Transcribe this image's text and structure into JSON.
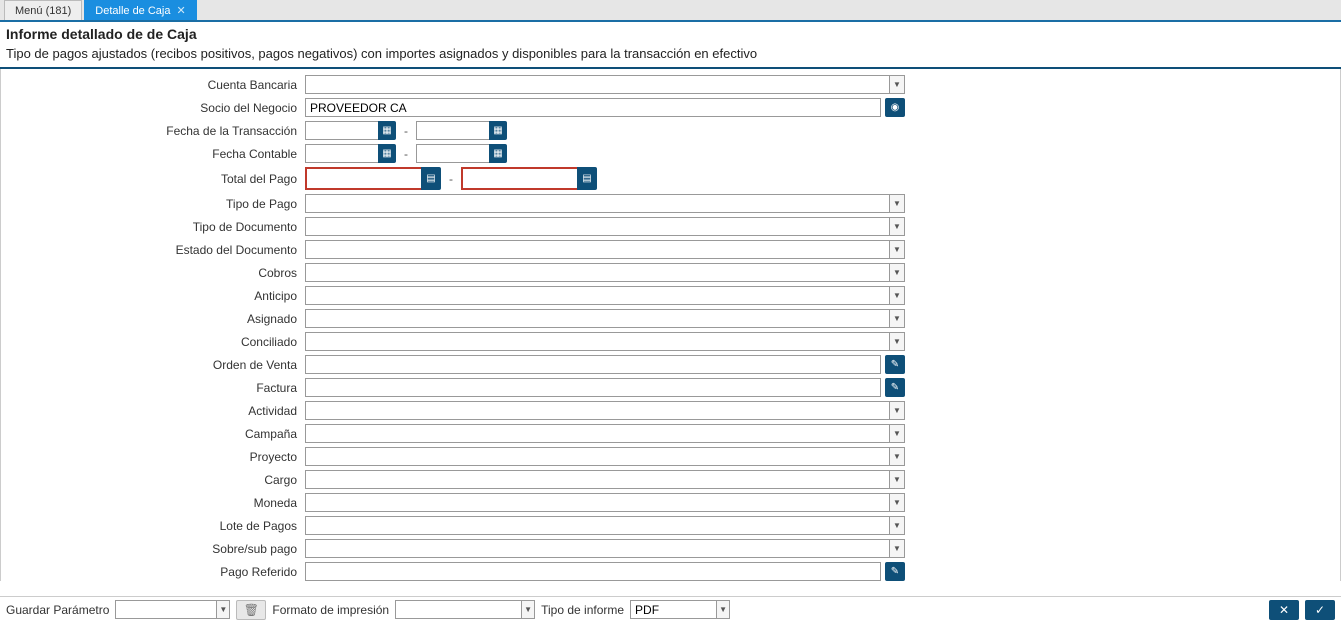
{
  "tabs": {
    "menu": "Menú (181)",
    "active": "Detalle de Caja"
  },
  "header": {
    "title": "Informe detallado de de Caja",
    "subtitle": "Tipo de pagos ajustados (recibos positivos, pagos negativos) con importes asignados y disponibles para la transacción en efectivo"
  },
  "labels": {
    "cuenta_bancaria": "Cuenta Bancaria",
    "socio_negocio": "Socio del Negocio",
    "fecha_transaccion": "Fecha de la Transacción",
    "fecha_contable": "Fecha Contable",
    "total_pago": "Total del Pago",
    "tipo_pago": "Tipo de Pago",
    "tipo_documento": "Tipo de Documento",
    "estado_documento": "Estado del Documento",
    "cobros": "Cobros",
    "anticipo": "Anticipo",
    "asignado": "Asignado",
    "conciliado": "Conciliado",
    "orden_venta": "Orden de Venta",
    "factura": "Factura",
    "actividad": "Actividad",
    "campana": "Campaña",
    "proyecto": "Proyecto",
    "cargo": "Cargo",
    "moneda": "Moneda",
    "lote_pagos": "Lote de Pagos",
    "sobre_sub_pago": "Sobre/sub pago",
    "pago_referido": "Pago Referido"
  },
  "values": {
    "cuenta_bancaria": "",
    "socio_negocio": "PROVEEDOR CA",
    "fecha_transaccion_from": "",
    "fecha_transaccion_to": "",
    "fecha_contable_from": "",
    "fecha_contable_to": "",
    "total_pago_from": "",
    "total_pago_to": "",
    "tipo_pago": "",
    "tipo_documento": "",
    "estado_documento": "",
    "cobros": "",
    "anticipo": "",
    "asignado": "",
    "conciliado": "",
    "orden_venta": "",
    "factura": "",
    "actividad": "",
    "campana": "",
    "proyecto": "",
    "cargo": "",
    "moneda": "",
    "lote_pagos": "",
    "sobre_sub_pago": "",
    "pago_referido": ""
  },
  "footer": {
    "guardar_parametro": "Guardar Parámetro",
    "guardar_parametro_value": "",
    "formato_impresion": "Formato de impresión",
    "formato_impresion_value": "",
    "tipo_informe": "Tipo de informe",
    "tipo_informe_value": "PDF"
  },
  "range_sep": "-"
}
